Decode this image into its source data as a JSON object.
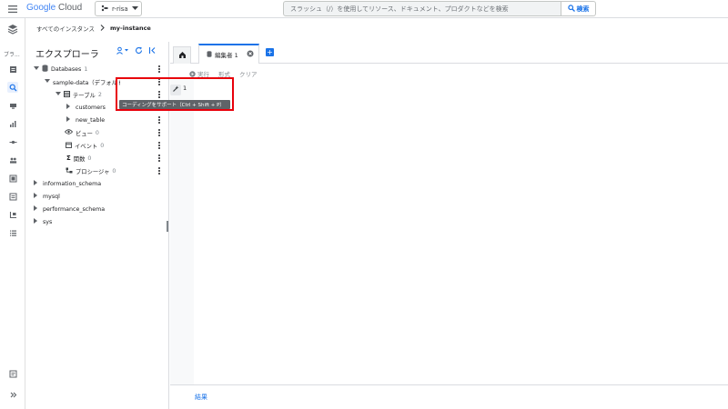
{
  "topbar": {
    "logo_google": "Google",
    "logo_cloud": "Cloud",
    "project": "r-risa",
    "search_placeholder": "スラッシュ（/）を使用してリソース、ドキュメント、プロダクトなどを検索",
    "search_button": "検索"
  },
  "breadcrumb": {
    "parent": "すべてのインスタンス",
    "current": "my-instance"
  },
  "rail": {
    "label": "ブラ..."
  },
  "explorer": {
    "title": "エクスプローラ",
    "databases_label": "Databases",
    "databases_count": "1",
    "db_name": "sample-data（デフォルト",
    "tables_label": "テーブル",
    "tables_count": "2",
    "tables": [
      "customers",
      "new_table"
    ],
    "views_label": "ビュー",
    "views_count": "0",
    "events_label": "イベント",
    "events_count": "0",
    "functions_label": "関数",
    "functions_count": "0",
    "procedures_label": "プロシージャ",
    "procedures_count": "0",
    "other_dbs": [
      "information_schema",
      "mysql",
      "performance_schema",
      "sys"
    ]
  },
  "editor": {
    "tab_label": "編集者 1",
    "run_label": "実行",
    "format_label": "形式",
    "clear_label": "クリア",
    "line_number": "1",
    "tooltip": "コーディングをサポート（Ctrl + Shift + P）",
    "results_label": "結果"
  },
  "colors": {
    "accent": "#1a73e8",
    "highlight": "#e8000b"
  }
}
